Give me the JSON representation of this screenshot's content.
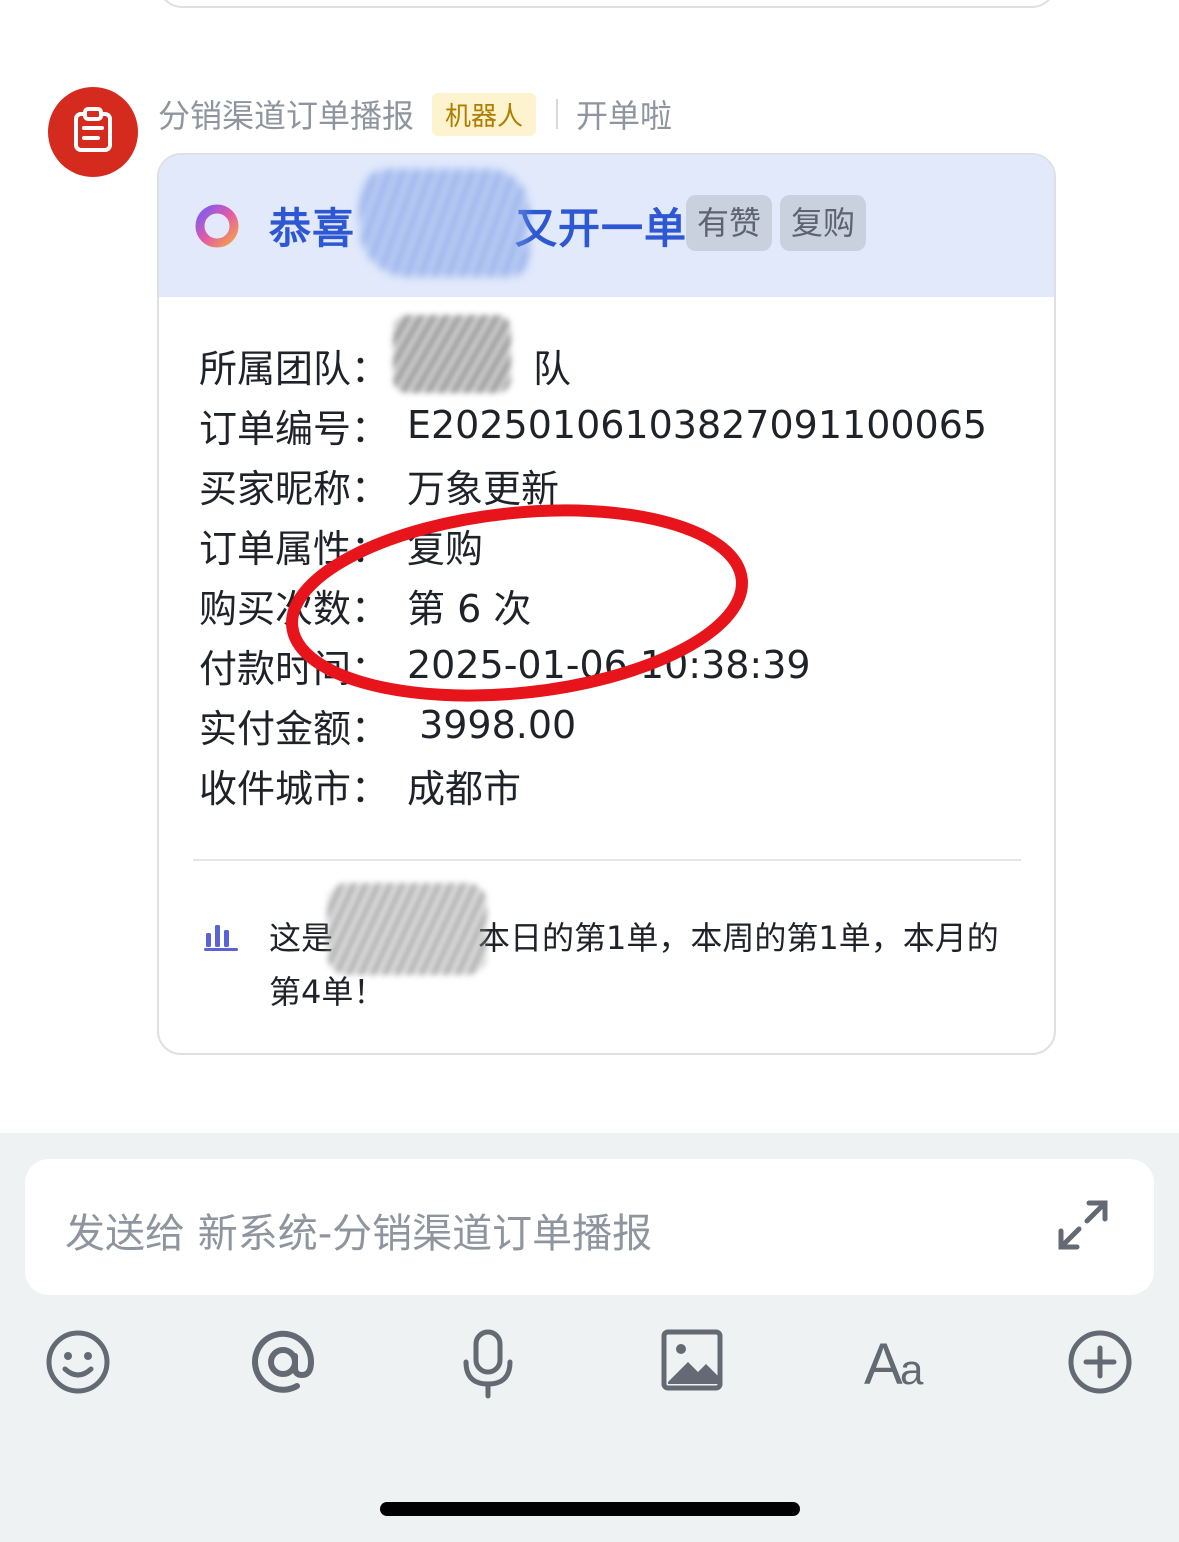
{
  "chat": {
    "sender_name": "分销渠道订单播报",
    "bot_badge": "机器人",
    "header_subtitle": "开单啦"
  },
  "card": {
    "title": "恭喜",
    "title_suffix": "又开一单！",
    "tags": [
      "有赞",
      "复购"
    ],
    "fields": [
      {
        "label": "所属团队：",
        "value": "队"
      },
      {
        "label": "订单编号：",
        "value": "E20250106103827091100065"
      },
      {
        "label": "买家昵称：",
        "value": "万象更新"
      },
      {
        "label": "订单属性：",
        "value": "复购"
      },
      {
        "label": "购买次数：",
        "value": "第 6 次"
      },
      {
        "label": "付款时间：",
        "value": "2025-01-06 10:38:39"
      },
      {
        "label": "实付金额：",
        "value": " 3998.00"
      },
      {
        "label": "收件城市：",
        "value": "成都市"
      }
    ],
    "stat_text_prefix": "这是",
    "stat_text": "本日的第1单，本周的第1单，本月的第4单！"
  },
  "composer": {
    "placeholder": "发送给 新系统-分销渠道订单播报"
  },
  "icons": {
    "avatar": "clipboard-icon",
    "header": "ring-logo-icon",
    "stat": "bar-chart-icon",
    "expand": "expand-icon",
    "toolbar": [
      "emoji-icon",
      "at-icon",
      "microphone-icon",
      "image-icon",
      "text-format-icon",
      "plus-circle-icon"
    ]
  },
  "colors": {
    "avatar_bg": "#d52b1e",
    "card_header_bg": "#e1e9fb",
    "title_color": "#2e57d3",
    "annotation_red": "#e8141b"
  }
}
